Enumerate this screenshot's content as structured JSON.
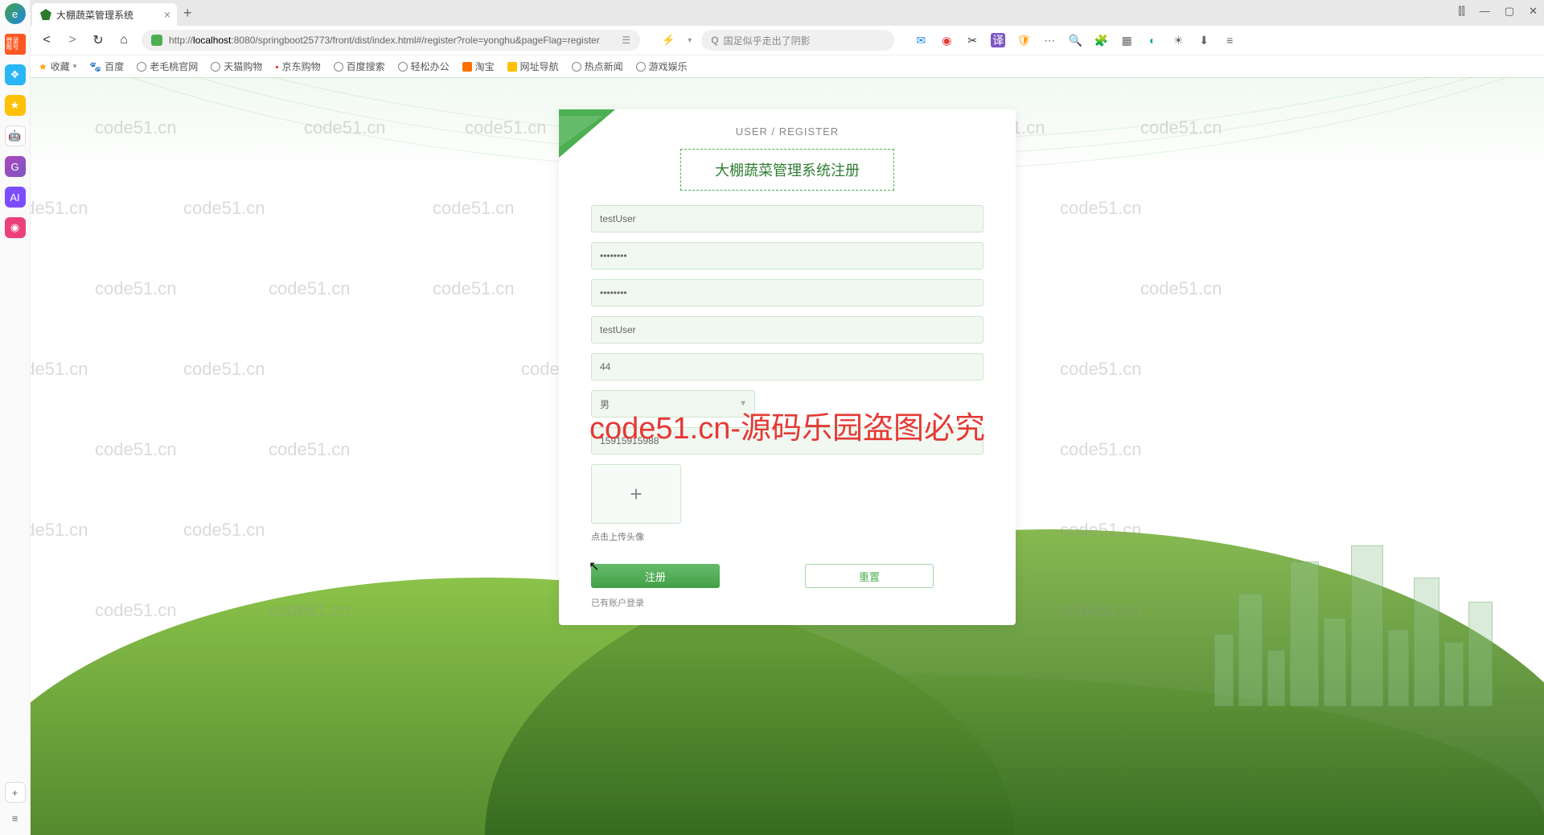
{
  "browser": {
    "tab_title": "大棚蔬菜管理系统",
    "url_prefix": "http://",
    "url_host": "localhost",
    "url_path": ":8080/springboot25773/front/dist/index.html#/register?role=yonghu&pageFlag=register",
    "search_placeholder": "国足似乎走出了阴影",
    "bookmarks": [
      "收藏",
      "百度",
      "老毛桃官网",
      "天猫购物",
      "京东购物",
      "百度搜索",
      "轻松办公",
      "淘宝",
      "网址导航",
      "热点新闻",
      "游戏娱乐"
    ]
  },
  "sidebar": {
    "login_label": "登录账号"
  },
  "watermark_text": "code51.cn",
  "big_watermark": "code51.cn-源码乐园盗图必究",
  "register": {
    "header": "USER / REGISTER",
    "title": "大棚蔬菜管理系统注册",
    "username": "testUser",
    "password": "••••••••",
    "confirm_password": "••••••••",
    "name": "testUser",
    "age": "44",
    "gender": "男",
    "phone": "15915915988",
    "upload_hint": "点击上传头像",
    "register_btn": "注册",
    "reset_btn": "重置",
    "login_link": "已有账户登录"
  }
}
